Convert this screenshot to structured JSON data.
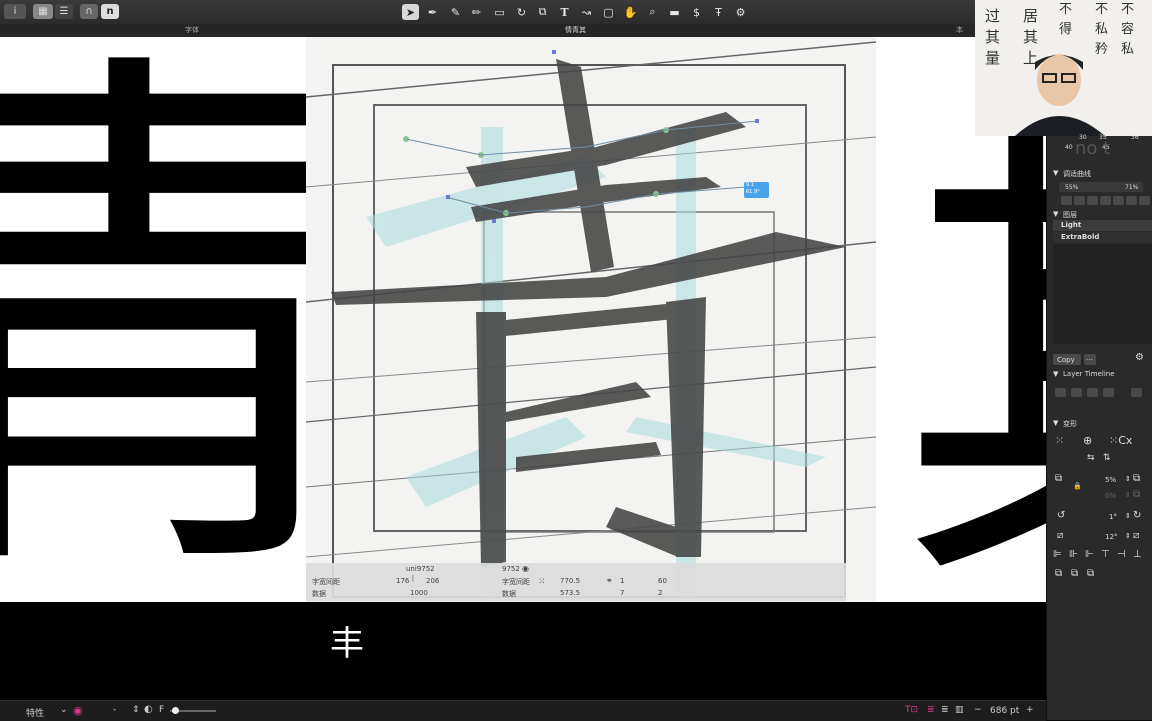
{
  "toolbar": {
    "left_buttons": [
      "i",
      "∩",
      "n"
    ],
    "tools": [
      "pointer-tool",
      "pen-tool",
      "brush-tool",
      "pencil-tool",
      "rectangle-tool",
      "rotate-tool",
      "scale-tool",
      "text-tool",
      "knife-tool",
      "comment-tool",
      "hand-tool",
      "zoom-tool",
      "ruler-tool",
      "dollar-tool",
      "t-tool",
      "settings-tool"
    ]
  },
  "tabs": {
    "tab1": "字体",
    "tab2": "情青其",
    "tab3": "本"
  },
  "canvas": {
    "left_glyph": "青",
    "scan_glyph": "青",
    "right_glyph": "其"
  },
  "info": {
    "glyph_name": "uni9752",
    "glyph_code": "9752",
    "label_width": "字宽间距",
    "lsb": "176",
    "rsb": "206",
    "label_bound": "数据",
    "width": "1000",
    "label_width2": "字宽间距",
    "label_bound2": "数据",
    "x": "770.5",
    "y": "573.5",
    "n1": "1",
    "n2": "7",
    "n3": "60",
    "n4": "2",
    "tooltip_line1": "9.1",
    "tooltip_line2": "61.9°"
  },
  "preview_glyph": "丰",
  "bottombar": {
    "feature_label": "特性",
    "f_label": "F",
    "zoom_value": "686 pt"
  },
  "panel": {
    "axis_numbers": [
      "30",
      "35",
      "36",
      "40",
      "45"
    ],
    "axis_word": "no t",
    "curve_label": "调适曲线",
    "pct_left": "55%",
    "pct_right": "71%",
    "layers_label": "图层",
    "layer_light": "Light",
    "layer_extrabold": "ExtraBold",
    "copy_label": "Copy",
    "timeline_label": "Layer Timeline",
    "transform_label": "变形",
    "scale_value": "5%",
    "scale_value2": "0%",
    "rotate_value": "1°",
    "slant_value": "12°"
  },
  "webcam": {
    "calligraphy_col1": "过其量",
    "calligraphy_col2": "居其上",
    "calligraphy_col3": "不得",
    "calligraphy_col4": "不私矜",
    "calligraphy_col5": "不容私"
  },
  "colors": {
    "accent_pink": "#e0358e",
    "tooltip_blue": "#4aa3e8",
    "panel_bg": "#2a2a2a"
  }
}
